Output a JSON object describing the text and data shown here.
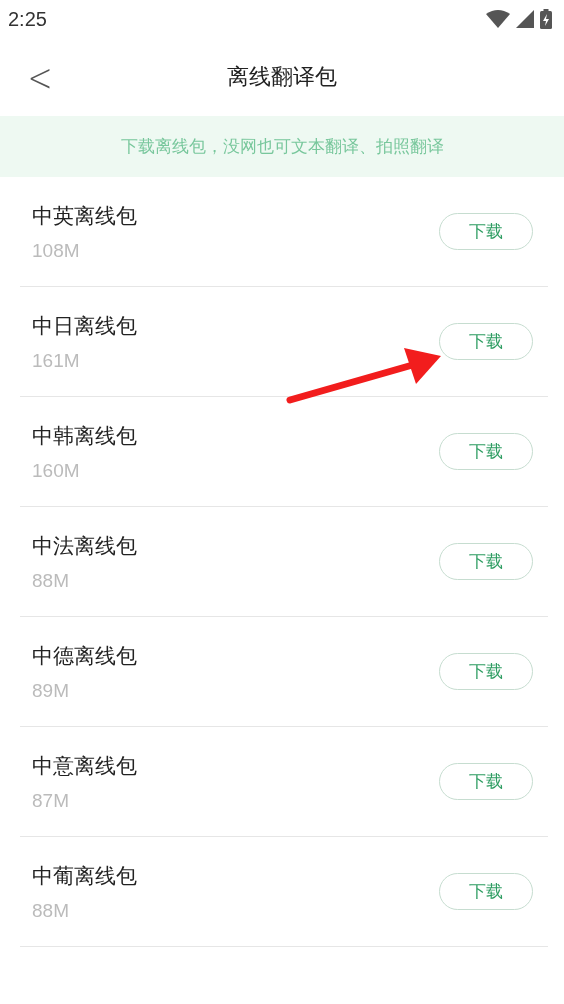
{
  "status_bar": {
    "time": "2:25"
  },
  "header": {
    "back": "<",
    "title": "离线翻译包"
  },
  "banner": {
    "text": "下载离线包，没网也可文本翻译、拍照翻译"
  },
  "packages": [
    {
      "name": "中英离线包",
      "size": "108M",
      "action": "下载"
    },
    {
      "name": "中日离线包",
      "size": "161M",
      "action": "下载"
    },
    {
      "name": "中韩离线包",
      "size": "160M",
      "action": "下载"
    },
    {
      "name": "中法离线包",
      "size": "88M",
      "action": "下载"
    },
    {
      "name": "中德离线包",
      "size": "89M",
      "action": "下载"
    },
    {
      "name": "中意离线包",
      "size": "87M",
      "action": "下载"
    },
    {
      "name": "中葡离线包",
      "size": "88M",
      "action": "下载"
    }
  ]
}
